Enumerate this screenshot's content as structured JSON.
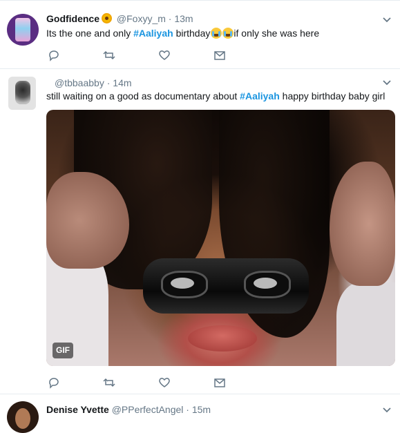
{
  "tweets": [
    {
      "name": "Godfidence",
      "handle": "@Foxyy_m",
      "time": "13m",
      "text_before": "Its the one and only ",
      "hashtag": "#Aaliyah",
      "text_after": " birthday",
      "text_end": "if only she was here"
    },
    {
      "name": "",
      "handle": "@tbbaabby",
      "time": "14m",
      "text_before": "still waiting on a good as documentary about  ",
      "hashtag": "#Aaliyah",
      "text_after": " happy birthday baby girl",
      "media_badge": "GIF"
    },
    {
      "name": "Denise Yvette",
      "handle": "@PPerfectAngel",
      "time": "15m"
    }
  ],
  "separator": "·",
  "icons": {
    "reply": "reply-icon",
    "retweet": "retweet-icon",
    "like": "like-icon",
    "dm": "direct-message-icon",
    "caret": "chevron-down-icon",
    "emoji_cry": "loudly-crying-face-emoji",
    "sunflower": "sunflower-emoji"
  },
  "colors": {
    "hashtag": "#1b95e0",
    "meta": "#657786",
    "text": "#14171a",
    "border": "#e6ecf0"
  }
}
